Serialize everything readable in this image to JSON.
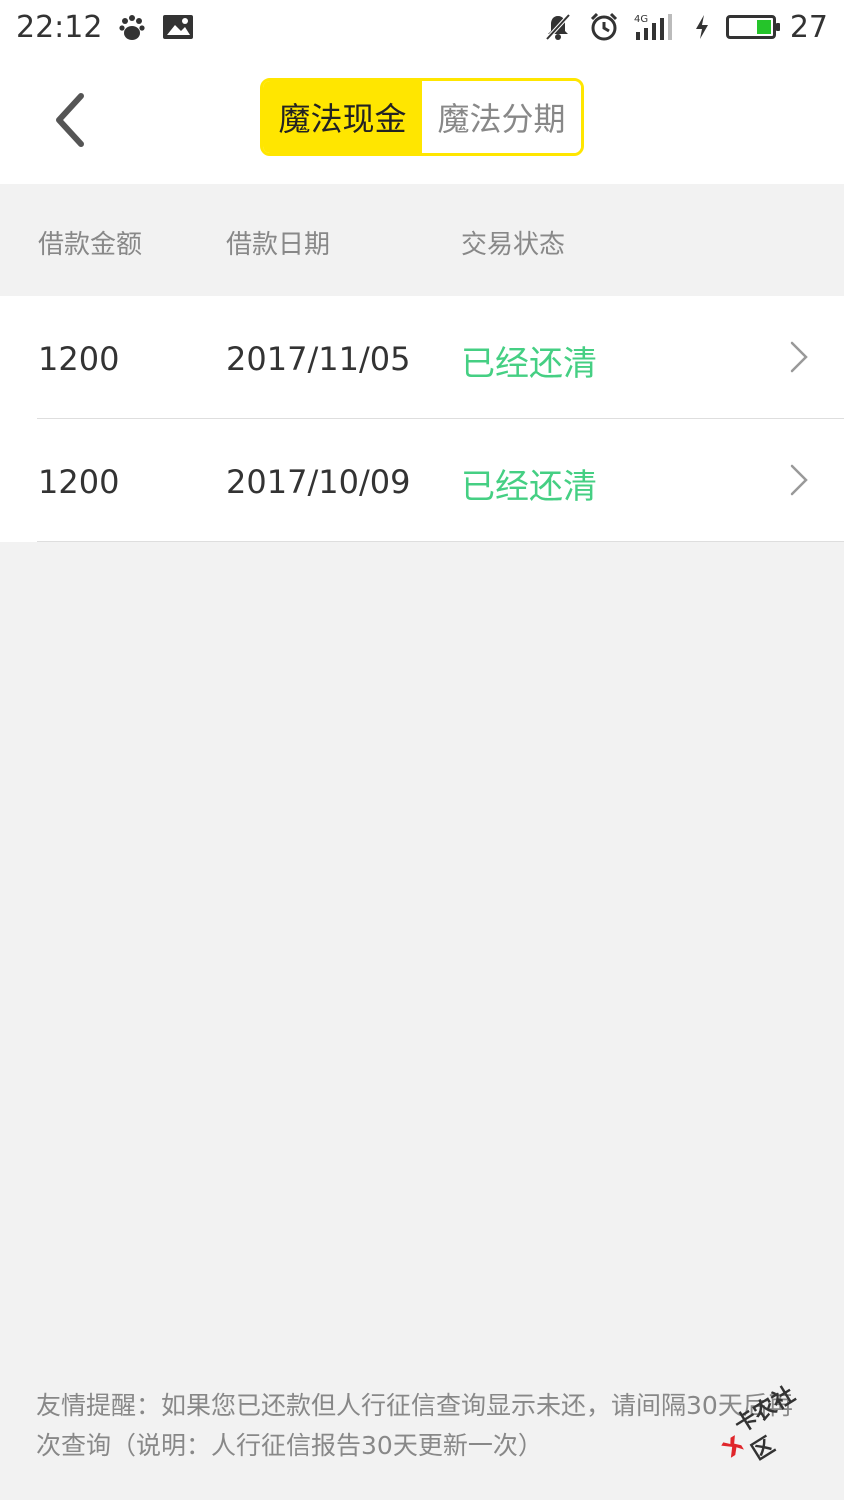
{
  "status_bar": {
    "time": "22:12",
    "battery_level": "27",
    "network": "4G",
    "icons": [
      "baidu-paw-icon",
      "image-icon",
      "mute-bell-icon",
      "alarm-icon",
      "signal-icon",
      "charging-icon",
      "battery-icon"
    ]
  },
  "header": {
    "tabs": [
      {
        "label": "魔法现金",
        "active": true
      },
      {
        "label": "魔法分期",
        "active": false
      }
    ],
    "accent_color": "#ffe600"
  },
  "table": {
    "columns": [
      "借款金额",
      "借款日期",
      "交易状态"
    ],
    "rows": [
      {
        "amount": "1200",
        "date": "2017/11/05",
        "status": "已经还清"
      },
      {
        "amount": "1200",
        "date": "2017/10/09",
        "status": "已经还清"
      }
    ],
    "status_color": "#45cf83"
  },
  "footer": {
    "tip": "友情提醒：如果您已还款但人行征信查询显示未还，请间隔30天后再次查询（说明：人行征信报告30天更新一次）"
  },
  "watermark": {
    "text": "卡农社区"
  }
}
